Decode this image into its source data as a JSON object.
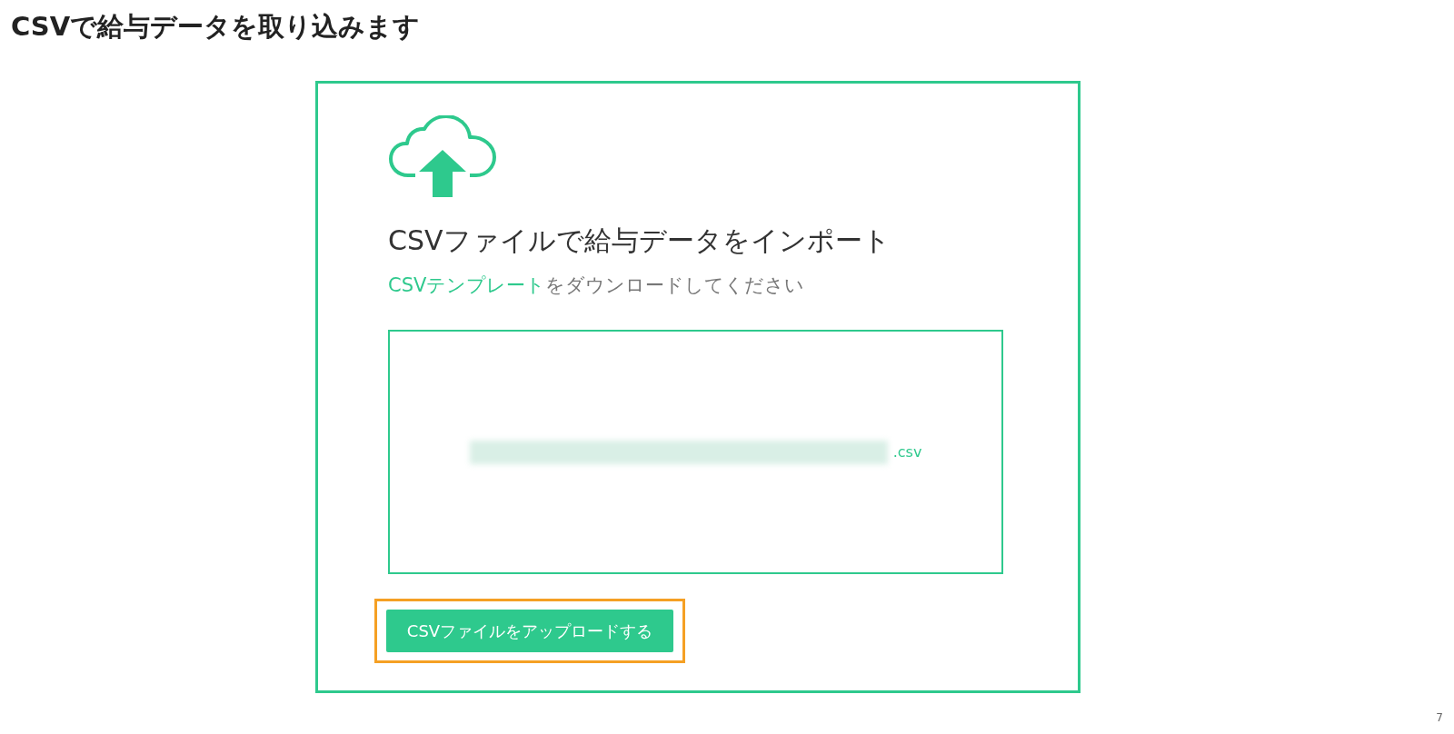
{
  "page_title": "CSVで給与データを取り込みます",
  "import_panel": {
    "heading": "CSVファイルで給与データをインポート",
    "instruction": {
      "link": "CSVテンプレート",
      "text": "をダウンロードしてください"
    },
    "dropzone": {
      "file_name": ".csv"
    },
    "upload_button": {
      "label": "CSVファイルをアップロードする",
      "highlighted": true
    }
  },
  "page_number": "7"
}
